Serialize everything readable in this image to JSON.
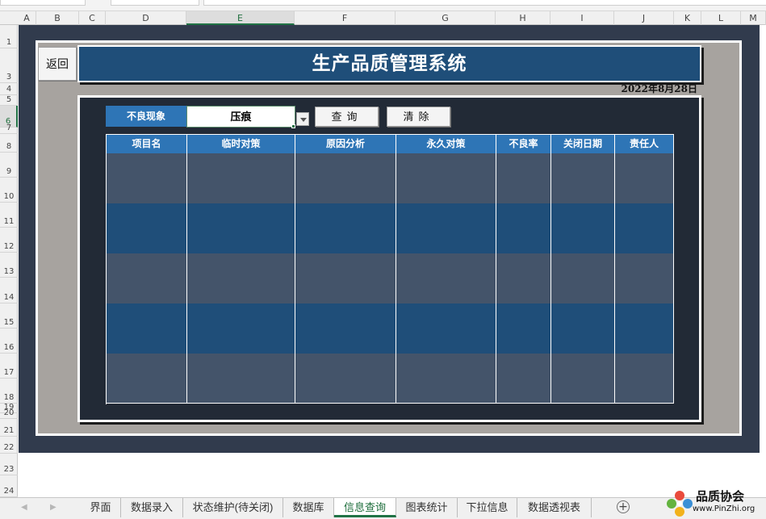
{
  "columns": [
    "A",
    "B",
    "C",
    "D",
    "E",
    "F",
    "G",
    "H",
    "I",
    "J",
    "K",
    "L",
    "M"
  ],
  "selected_column": "E",
  "rows": [
    "1",
    "3",
    "4",
    "5",
    "6",
    "7",
    "8",
    "9",
    "10",
    "11",
    "12",
    "13",
    "14",
    "15",
    "16",
    "17",
    "18",
    "19",
    "20",
    "21",
    "22",
    "23",
    "24"
  ],
  "selected_row": "6",
  "dashboard": {
    "back_label": "返回",
    "title": "生产品质管理系统",
    "date": "2022年8月28日",
    "filter_label": "不良现象",
    "filter_value": "压痕",
    "query_label": "查询",
    "clear_label": "清除",
    "table": {
      "headers": [
        "项目名",
        "临时对策",
        "原因分析",
        "永久对策",
        "不良率",
        "关闭日期",
        "责任人"
      ],
      "row_count": 5
    }
  },
  "sheet_tabs": [
    "界面",
    "数据录入",
    "状态维护(待关闭)",
    "数据库",
    "信息查询",
    "图表统计",
    "下拉信息",
    "数据透视表"
  ],
  "active_tab": "信息查询",
  "add_sheet_label": "+",
  "brand": {
    "name": "品质协会",
    "url": "www.PinZhi.org"
  },
  "colors": {
    "background": "#313b4d",
    "title_bar": "#1f4e79",
    "header_cell": "#2e75b6",
    "row_light": "#44546a",
    "row_dark": "#1f4e79",
    "frame": "#a7a39f",
    "excel_green": "#217346"
  },
  "icons": {
    "add_sheet": "plus-circle-icon",
    "dropdown": "chevron-down-icon"
  }
}
